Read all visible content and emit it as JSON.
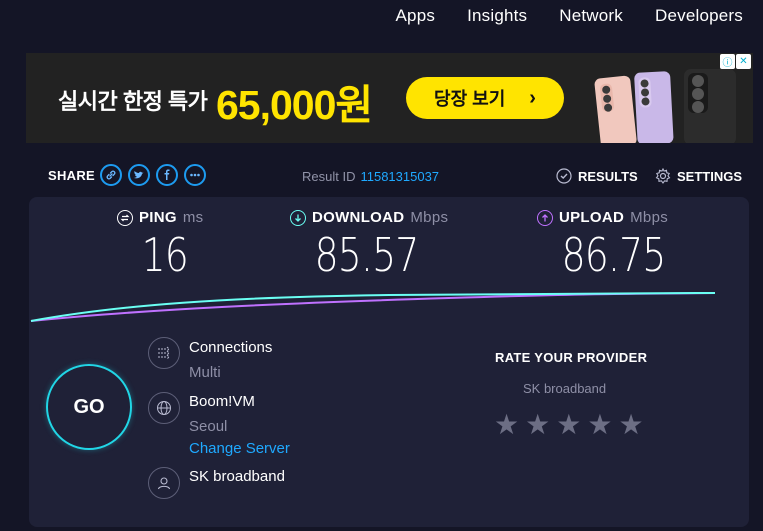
{
  "nav": {
    "items": [
      {
        "label": "Apps"
      },
      {
        "label": "Insights"
      },
      {
        "label": "Network"
      },
      {
        "label": "Developers"
      }
    ]
  },
  "ad": {
    "text": "실시간 한정 특가",
    "price": "65,000원",
    "button_label": "당장 보기",
    "button_chevron": "›",
    "info_icons": [
      "info-icon",
      "close-icon"
    ]
  },
  "share": {
    "label": "SHARE",
    "icons": [
      "link-icon",
      "twitter-icon",
      "facebook-icon",
      "more-icon"
    ],
    "result_id_label": "Result ID",
    "result_id": "11581315037",
    "results_label": "RESULTS",
    "settings_label": "SETTINGS"
  },
  "metrics": {
    "ping": {
      "label": "PING",
      "unit": "ms",
      "value": "16",
      "icon": "ping-icon",
      "color": "#ffffff"
    },
    "download": {
      "label": "DOWNLOAD",
      "unit": "Mbps",
      "value": "85.57",
      "icon": "download-icon",
      "color": "#6afff3"
    },
    "upload": {
      "label": "UPLOAD",
      "unit": "Mbps",
      "value": "86.75",
      "icon": "upload-icon",
      "color": "#bf71ff"
    }
  },
  "go": {
    "label": "GO"
  },
  "connection": {
    "title": "Connections",
    "sub": "Multi",
    "icon": "connections-icon"
  },
  "server": {
    "title": "Boom!VM",
    "sub": "Seoul",
    "link": "Change Server",
    "icon": "globe-icon"
  },
  "provider": {
    "title": "SK broadband",
    "icon": "user-icon"
  },
  "rate": {
    "title": "RATE YOUR PROVIDER",
    "provider": "SK broadband",
    "stars": 5
  },
  "colors": {
    "accent_blue": "#1fa9ff",
    "download_line": "#6afff3",
    "upload_line": "#bf71ff",
    "go_ring": "#21d6e6",
    "ad_yellow": "#ffe400",
    "panel_bg": "#1f2137",
    "page_bg": "#141526"
  }
}
